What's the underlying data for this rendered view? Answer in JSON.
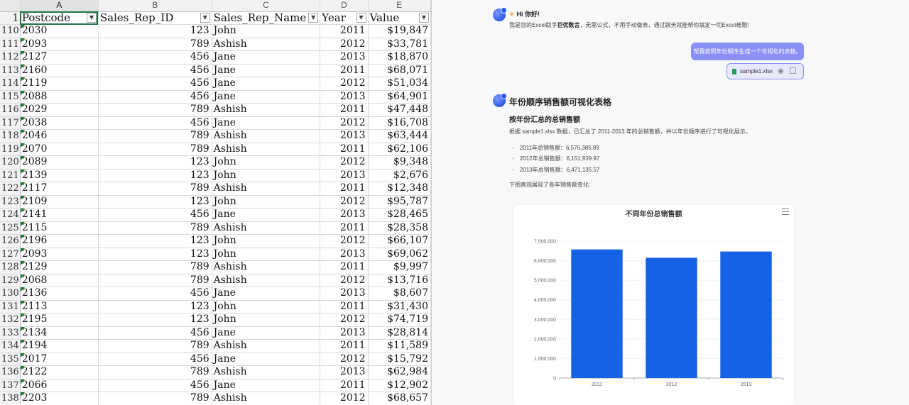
{
  "sheet": {
    "columns": [
      "A",
      "B",
      "C",
      "D",
      "E"
    ],
    "header_row_number": "1",
    "headers": [
      "Postcode",
      "Sales_Rep_ID",
      "Sales_Rep_Name",
      "Year",
      "Value"
    ],
    "filter_icon": "dropdown-arrow-icon",
    "rows": [
      [
        "110",
        "2030",
        "123",
        "John",
        "2011",
        "$19,847"
      ],
      [
        "111",
        "2093",
        "789",
        "Ashish",
        "2012",
        "$33,781"
      ],
      [
        "112",
        "2127",
        "456",
        "Jane",
        "2013",
        "$18,870"
      ],
      [
        "113",
        "2160",
        "456",
        "Jane",
        "2011",
        "$68,071"
      ],
      [
        "114",
        "2119",
        "456",
        "Jane",
        "2012",
        "$51,034"
      ],
      [
        "115",
        "2088",
        "456",
        "Jane",
        "2013",
        "$64,901"
      ],
      [
        "116",
        "2029",
        "789",
        "Ashish",
        "2011",
        "$47,448"
      ],
      [
        "117",
        "2038",
        "456",
        "Jane",
        "2012",
        "$16,708"
      ],
      [
        "118",
        "2046",
        "789",
        "Ashish",
        "2013",
        "$63,444"
      ],
      [
        "119",
        "2070",
        "789",
        "Ashish",
        "2011",
        "$62,106"
      ],
      [
        "120",
        "2089",
        "123",
        "John",
        "2012",
        "$9,348"
      ],
      [
        "121",
        "2139",
        "123",
        "John",
        "2013",
        "$2,676"
      ],
      [
        "122",
        "2117",
        "789",
        "Ashish",
        "2011",
        "$12,348"
      ],
      [
        "123",
        "2109",
        "123",
        "John",
        "2012",
        "$95,787"
      ],
      [
        "124",
        "2141",
        "456",
        "Jane",
        "2013",
        "$28,465"
      ],
      [
        "125",
        "2115",
        "789",
        "Ashish",
        "2011",
        "$28,358"
      ],
      [
        "126",
        "2196",
        "123",
        "John",
        "2012",
        "$66,107"
      ],
      [
        "127",
        "2093",
        "123",
        "John",
        "2013",
        "$69,062"
      ],
      [
        "128",
        "2129",
        "789",
        "Ashish",
        "2011",
        "$9,997"
      ],
      [
        "129",
        "2068",
        "789",
        "Ashish",
        "2012",
        "$13,716"
      ],
      [
        "130",
        "2136",
        "456",
        "Jane",
        "2013",
        "$8,607"
      ],
      [
        "131",
        "2113",
        "123",
        "John",
        "2011",
        "$31,430"
      ],
      [
        "132",
        "2195",
        "123",
        "John",
        "2012",
        "$74,719"
      ],
      [
        "133",
        "2134",
        "456",
        "Jane",
        "2013",
        "$28,814"
      ],
      [
        "134",
        "2194",
        "789",
        "Ashish",
        "2011",
        "$11,589"
      ],
      [
        "135",
        "2017",
        "456",
        "Jane",
        "2012",
        "$15,792"
      ],
      [
        "136",
        "2122",
        "789",
        "Ashish",
        "2013",
        "$62,984"
      ],
      [
        "137",
        "2066",
        "456",
        "Jane",
        "2011",
        "$12,902"
      ],
      [
        "138",
        "2203",
        "789",
        "Ashish",
        "2012",
        "$68,657"
      ]
    ]
  },
  "chat": {
    "greeting": {
      "icon": "sparkle-icon",
      "title": "Hi 你好!",
      "sub_prefix": "我是您的Excel助手",
      "sub_bold": "巨优数言",
      "sub_suffix": "，无需公式，不用手动做表，通过聊天就能帮你搞定一切Excel难题!"
    },
    "user_message": "帮我按照年份顺序生成一个可视化的表格。",
    "attachment": {
      "file_name": "sample1.xlsx",
      "icons": [
        "excel-file-icon",
        "eye-icon",
        "copy-icon"
      ]
    },
    "response": {
      "title": "年份顺序销售额可视化表格",
      "section_title": "按年份汇总的总销售额",
      "intro": "根据 sample1.xlsx 数据，已汇总了 2011-2013 年的总销售额，并以年份顺序进行了可视化展示。",
      "bullets": [
        "2011年总销售额：6,576,385.89",
        "2012年总销售额：6,151,939.97",
        "2013年总销售额：6,471,135.57"
      ],
      "outro": "下图直观展现了各年销售额变化:"
    },
    "chart_menu_icon": "hamburger-menu-icon"
  },
  "chart_data": {
    "type": "bar",
    "title": "不同年份总销售额",
    "categories": [
      "2011",
      "2012",
      "2013"
    ],
    "values": [
      6576385.89,
      6151939.97,
      6471135.57
    ],
    "xlabel": "",
    "ylabel": "",
    "ylim": [
      0,
      7000000
    ],
    "yticks": [
      0,
      1000000,
      2000000,
      3000000,
      4000000,
      5000000,
      6000000,
      7000000
    ],
    "ytick_labels": [
      "0",
      "1,000,000",
      "2,000,000",
      "3,000,000",
      "4,000,000",
      "5,000,000",
      "6,000,000",
      "7,000,000"
    ],
    "grid": true,
    "legend": "none",
    "bar_color": "#1662e6"
  }
}
